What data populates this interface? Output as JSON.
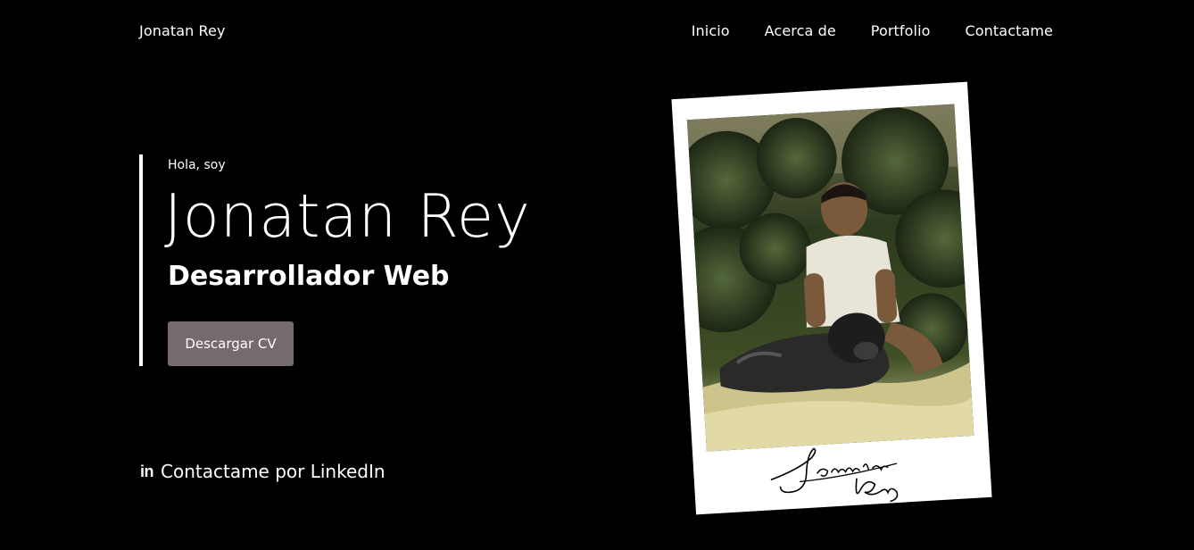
{
  "nav": {
    "brand": "Jonatan Rey",
    "links": [
      "Inicio",
      "Acerca de",
      "Portfolio",
      "Contactame"
    ]
  },
  "hero": {
    "greeting": "Hola, soy",
    "name": "Jonatan Rey",
    "role": "Desarrollador Web",
    "cv_button": "Descargar CV"
  },
  "contact": {
    "icon": "linkedin-icon",
    "icon_text": "in",
    "label": "Contactame por LinkedIn"
  },
  "colors": {
    "background": "#000000",
    "text": "#ffffff",
    "button": "#756b6c"
  }
}
